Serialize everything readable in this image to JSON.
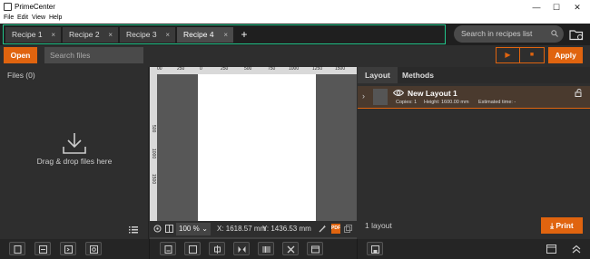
{
  "window": {
    "title": "PrimeCenter",
    "minimize_glyph": "—",
    "maximize_glyph": "☐",
    "close_glyph": "✕"
  },
  "menu": [
    "File",
    "Edit",
    "View",
    "Help"
  ],
  "tabs": [
    {
      "label": "Recipe 1",
      "close": "×",
      "active": false
    },
    {
      "label": "Recipe 2",
      "close": "×",
      "active": false
    },
    {
      "label": "Recipe 3",
      "close": "×",
      "active": false
    },
    {
      "label": "Recipe 4",
      "close": "×",
      "active": true
    }
  ],
  "tab_add": "+",
  "recipe_search": {
    "placeholder": "Search in recipes list",
    "icon": "search-icon"
  },
  "toolbar": {
    "open_label": "Open",
    "search_placeholder": "Search files",
    "play_glyph": "▶",
    "stop_glyph": "■",
    "apply_label": "Apply"
  },
  "left_panel": {
    "files_label": "Files (0)",
    "drop_text": "Drag & drop files here"
  },
  "ruler": {
    "top_labels": [
      "00",
      "250",
      "0",
      "250",
      "500",
      "750",
      "1000",
      "1250",
      "1500"
    ],
    "left_labels": [
      "500",
      "1000",
      "1500"
    ]
  },
  "status": {
    "zoom": "100 %",
    "zoom_dropdown": "⌄",
    "x_coord": "X: 1618.57 mm",
    "y_coord": "Y: 1436.53 mm",
    "pdf_label": "PDF"
  },
  "right_panel": {
    "tabs": [
      "Layout",
      "Methods"
    ],
    "active_tab": "Layout",
    "layout_item": {
      "chevron": "›",
      "name": "New Layout 1",
      "copies": "Copies: 1",
      "height": "Height: 1600.00 mm",
      "estimated": "Estimated time: -"
    },
    "layout_count": "1 layout",
    "print_label": "Print"
  },
  "colors": {
    "accent": "#e0640f",
    "tab_highlight": "#22c58a",
    "background": "#2e2e2e"
  }
}
